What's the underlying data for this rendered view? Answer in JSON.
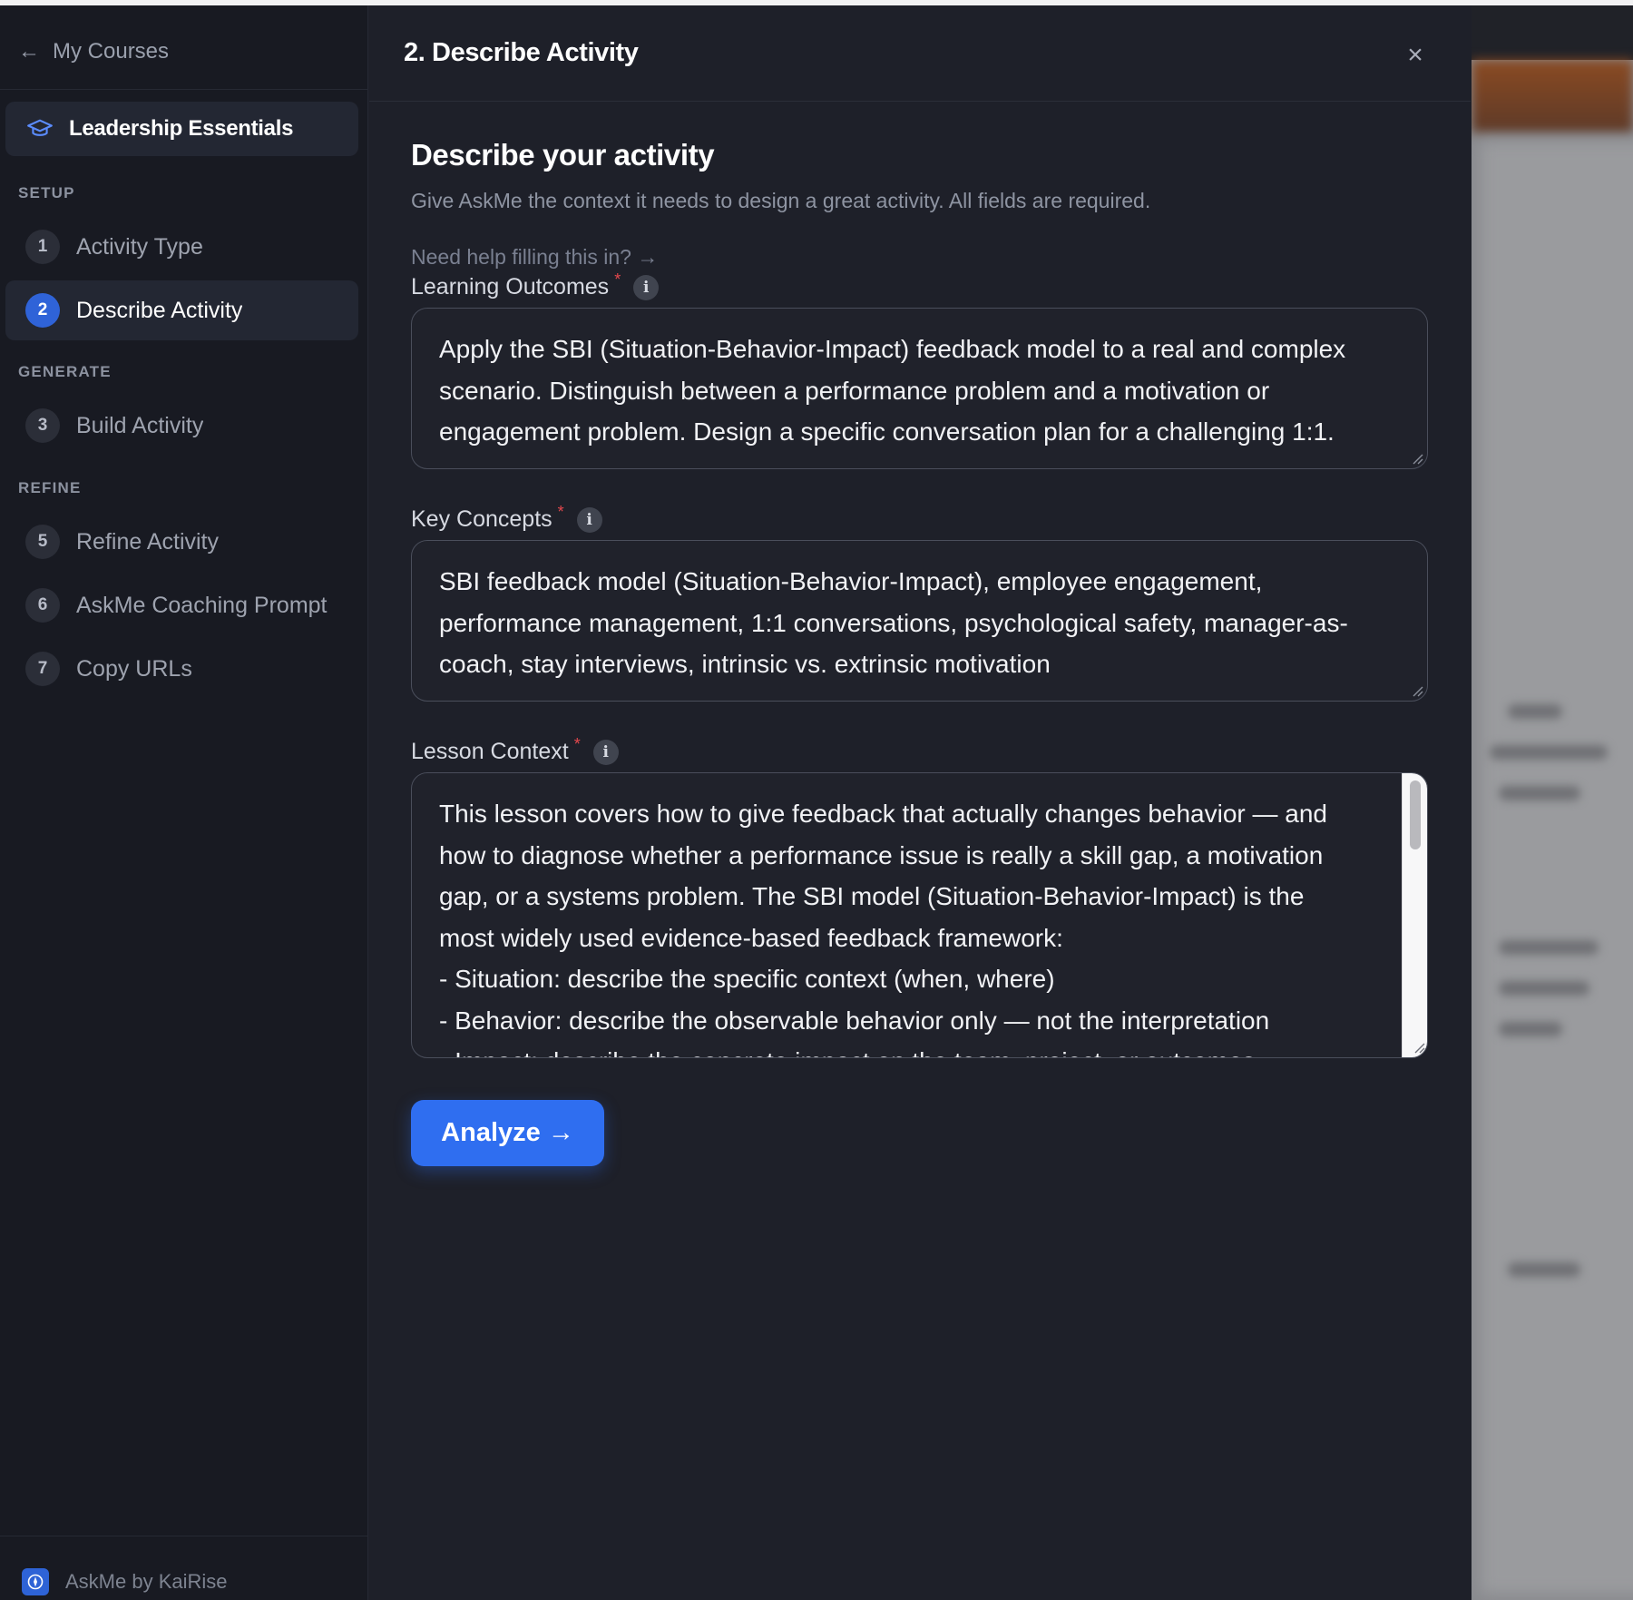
{
  "sidebar": {
    "back_label": "My Courses",
    "course_title": "Leadership Essentials",
    "sections": [
      {
        "label": "SETUP"
      },
      {
        "label": "GENERATE"
      },
      {
        "label": "REFINE"
      }
    ],
    "items": [
      {
        "num": "1",
        "label": "Activity Type"
      },
      {
        "num": "2",
        "label": "Describe Activity"
      },
      {
        "num": "3",
        "label": "Build Activity"
      },
      {
        "num": "5",
        "label": "Refine Activity"
      },
      {
        "num": "6",
        "label": "AskMe Coaching Prompt"
      },
      {
        "num": "7",
        "label": "Copy URLs"
      }
    ],
    "footer_label": "AskMe by KaiRise"
  },
  "panel": {
    "title": "2. Describe Activity",
    "close_symbol": "×",
    "heading": "Describe your activity",
    "subtitle": "Give AskMe the context it needs to design a great activity. All fields are required.",
    "help_link": "Need help filling this in? →",
    "required_marker": "*",
    "info_symbol": "i",
    "fields": {
      "learning_outcomes": {
        "label": "Learning Outcomes",
        "lines": [
          "Apply the SBI (Situation-Behavior-Impact) feedback model to a real and complex",
          "scenario. Distinguish between a performance problem and a motivation or",
          "engagement problem. Design a specific conversation plan for a challenging 1:1."
        ]
      },
      "key_concepts": {
        "label": "Key Concepts",
        "lines": [
          "SBI feedback model (Situation-Behavior-Impact), employee engagement,",
          "performance management, 1:1 conversations, psychological safety, manager-as-",
          "coach, stay interviews, intrinsic vs. extrinsic motivation"
        ]
      },
      "lesson_context": {
        "label": "Lesson Context",
        "lines": [
          "This lesson covers how to give feedback that actually changes behavior — and",
          "how to diagnose whether a performance issue is really a skill gap, a motivation",
          "gap, or a systems problem. The SBI model (Situation-Behavior-Impact) is the",
          "most widely used evidence-based feedback framework:",
          "- Situation: describe the specific context (when, where)",
          "- Behavior: describe the observable behavior only — not the interpretation",
          "- Impact: describe the concrete impact on the team, project, or outcomes"
        ]
      }
    },
    "analyze_label": "Analyze →"
  },
  "colors": {
    "accent": "#2f6ef0",
    "active_step": "#2f63d8",
    "required": "#e5484d",
    "panel_bg": "#1e2029",
    "sidebar_bg": "#181a22"
  }
}
